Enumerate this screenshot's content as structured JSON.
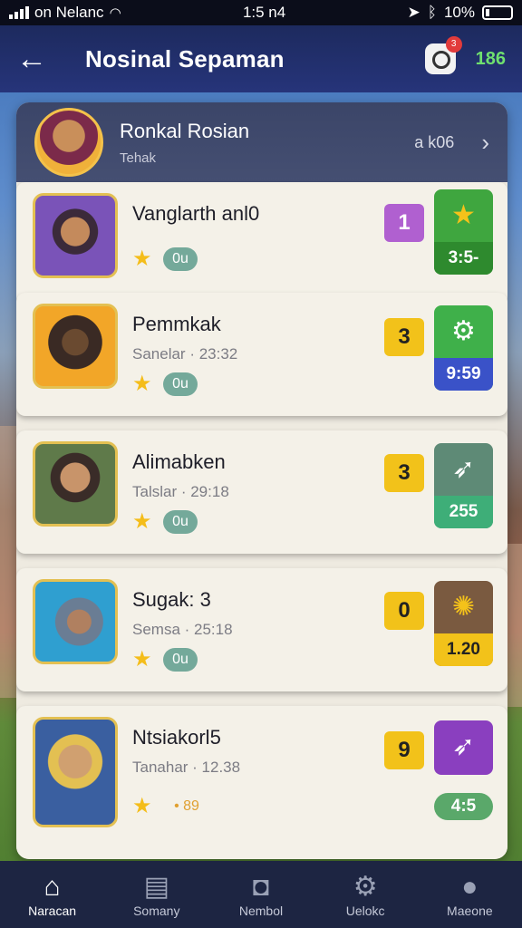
{
  "status": {
    "carrier": "on Nelanc",
    "time": "1:5 n4",
    "battery": "10%"
  },
  "nav": {
    "title": "Nosinal Sepaman",
    "badge": "3",
    "count": "186"
  },
  "header": {
    "name": "Ronkal Rosian",
    "subtitle": "Tehak",
    "right": "a k06"
  },
  "rows": [
    {
      "name": "Vanglarth anl0",
      "sub": "",
      "pill": "0u",
      "rank": "1",
      "tile_value": "3:5-"
    },
    {
      "name": "Pemmkak",
      "sub": "Sanelar · 23:32",
      "pill": "0u",
      "rank": "3",
      "tile_value": "9:59"
    },
    {
      "name": "Alimabken",
      "sub": "Talslar · 29:18",
      "pill": "0u",
      "rank": "3",
      "tile_value": "255"
    },
    {
      "name": "Sugak: 3",
      "sub": "Semsa · 25:18",
      "pill": "0u",
      "rank": "0",
      "tile_value": "1.20"
    },
    {
      "name": "Ntsiakorl5",
      "sub": "Tanahar · 12.38",
      "pill": "",
      "rank": "9",
      "tile_value": "4:5"
    }
  ],
  "footer_stat": "• 89",
  "tabs": [
    {
      "label": "Naracan"
    },
    {
      "label": "Somany"
    },
    {
      "label": "Nembol"
    },
    {
      "label": "Uelokc"
    },
    {
      "label": "Maeone"
    }
  ],
  "colors": {
    "nav_bg": "#26347a",
    "count": "#6fe06f",
    "tab_bg": "#1d2542"
  },
  "icons": [
    "back-arrow",
    "camera",
    "chevron-right",
    "star",
    "home",
    "newspaper",
    "camera-box",
    "gear",
    "person"
  ]
}
